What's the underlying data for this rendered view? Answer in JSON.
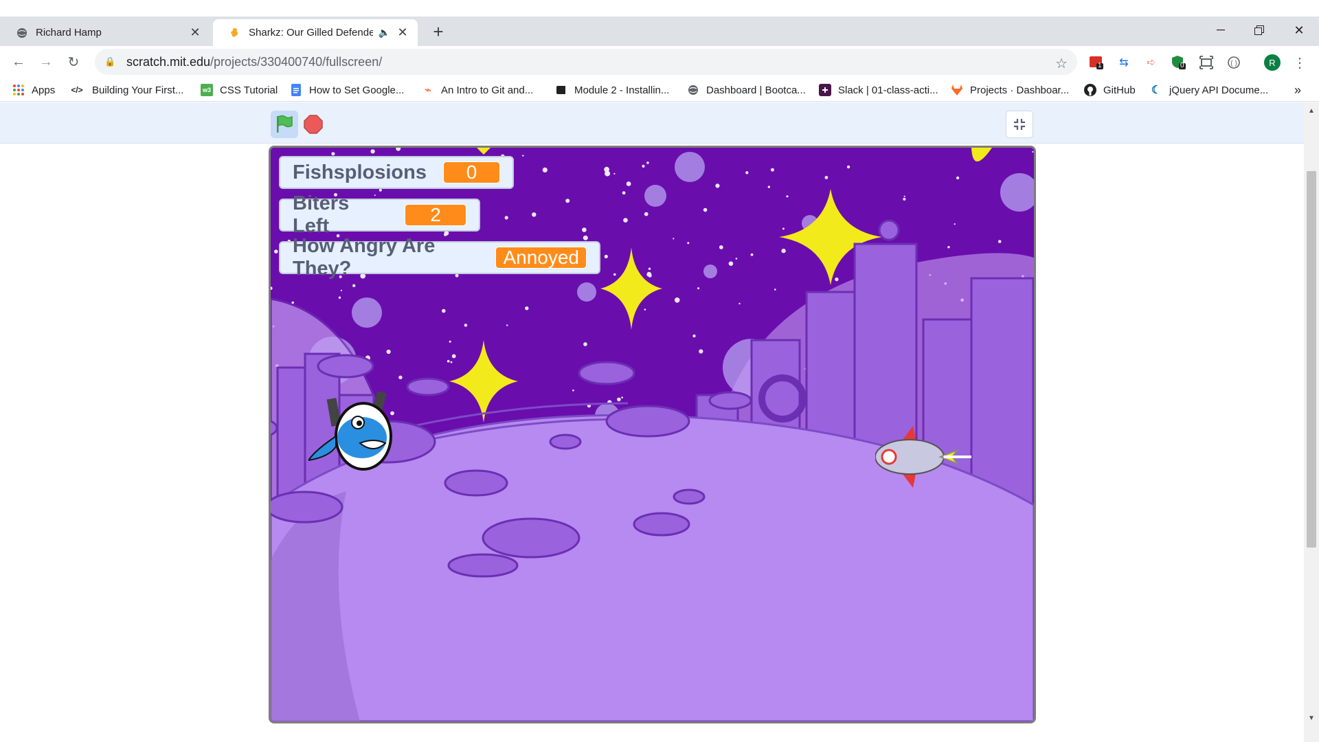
{
  "browser": {
    "tabs": [
      {
        "title": "Richard Hamp",
        "favicon": "globe-icon",
        "active": false
      },
      {
        "title": "Sharkz: Our Gilled Defenders on Scratch",
        "favicon": "scratch-icon",
        "active": true,
        "audio": "speaker-icon"
      }
    ],
    "new_tab_label": "+",
    "url_host": "scratch.mit.edu",
    "url_path": "/projects/330400740/fullscreen/",
    "profile_initial": "R",
    "extension_badges": [
      "1",
      "0"
    ],
    "bookmarks": [
      {
        "label": "Apps",
        "icon": "apps-grid-icon"
      },
      {
        "label": "Building Your First...",
        "icon": "code-icon"
      },
      {
        "label": "CSS Tutorial",
        "icon": "w3-icon"
      },
      {
        "label": "How to Set Google...",
        "icon": "doc-icon"
      },
      {
        "label": "An Intro to Git and...",
        "icon": "hubspot-icon"
      },
      {
        "label": "Module 2 - Installin...",
        "icon": "book-icon"
      },
      {
        "label": "Dashboard | Bootca...",
        "icon": "globe-icon"
      },
      {
        "label": "Slack | 01-class-acti...",
        "icon": "slack-icon"
      },
      {
        "label": "Projects · Dashboar...",
        "icon": "gitlab-icon"
      },
      {
        "label": "GitHub",
        "icon": "github-icon"
      },
      {
        "label": "jQuery API Docume...",
        "icon": "jquery-icon"
      }
    ],
    "bookmarks_overflow": "»"
  },
  "scratch": {
    "monitors": [
      {
        "label": "Fishsplosions",
        "value": "0"
      },
      {
        "label": "Biters Left",
        "value": "2"
      },
      {
        "label": "How Angry Are They?",
        "value": "Annoyed"
      }
    ]
  },
  "colors": {
    "sky": "#6a0dad",
    "moon": "#b68af0",
    "monitor_value": "#ff8c1a",
    "scratch_bar": "#e9f1fc"
  }
}
